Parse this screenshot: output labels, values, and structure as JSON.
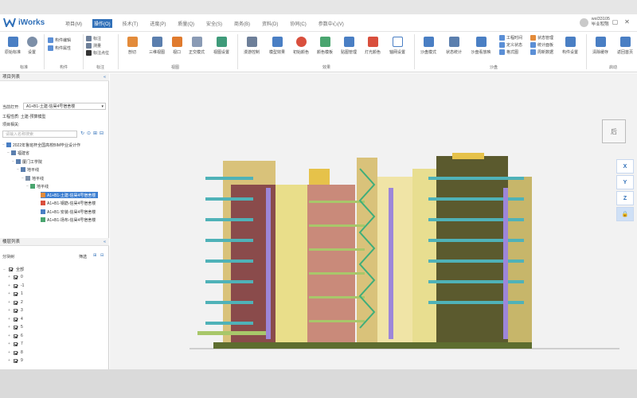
{
  "app": {
    "name": "iWorks",
    "menus": [
      "项目(M)",
      "操作(O)",
      "技术(T)",
      "进度(P)",
      "质量(Q)",
      "安全(S)",
      "商务(B)",
      "资料(D)",
      "协同(C)",
      "参数中心(V)"
    ],
    "active_menu": "操作(O)",
    "user_name": "wsl33105",
    "user_sub": "毕业权限",
    "window_buttons": [
      "—",
      "▢",
      "✕"
    ]
  },
  "ribbon": {
    "groups": [
      "标准",
      "构件",
      "标注",
      "视图",
      "效果",
      "沙盘",
      "启动"
    ],
    "buttons": {
      "origin_std": "原始标准",
      "settings": "设置",
      "comp_edit": "构件编辑",
      "comp_attr": "构件属性",
      "mark": "标注",
      "measure": "测量",
      "mark_points": "标注点位",
      "cut": "剖切",
      "three_view": "三维视图",
      "viewport": "视口",
      "ortho": "正交模式",
      "view_settings": "视图设置",
      "view_control": "漫游控制",
      "model_effect": "模型效果",
      "init_color": "初始颜色",
      "color_template": "颜色模板",
      "texture_manage": "贴图管理",
      "light_color": "灯光颜色",
      "grid_settings": "轴网设置",
      "sandbox_mode": "沙盘模式",
      "status_stats": "状态统计",
      "sandbox_marks": "沙盘看放映",
      "project_time": "工程时间",
      "define_status": "定义状态",
      "legend": "格式图",
      "status_manage": "状态管理",
      "stats_panel": "统计面板",
      "count_data": "周新数据",
      "comp_settings": "构件设置",
      "clear_cache": "清除缓存",
      "back_home": "返回首页"
    }
  },
  "project_panel": {
    "title": "项目列表",
    "current_open_label": "当前打开:",
    "current_open_value": "A1+B1-土建-信昊4号宿舍楼",
    "project_type": "工程性质: 土建-预算模型",
    "related_label": "项目相关:",
    "search_placeholder": "请输入名称搜索",
    "tree": [
      "2022年鲁班杯全国高校BIM毕业设计作",
      "福建省",
      "厦门工学院",
      "地平线",
      "地平线",
      "地平线",
      "A1+B1-土建-信昊4号宿舍楼",
      "A1+B1-钢筋-信昊4号宿舍楼",
      "A1+B1-安装-信昊4号宿舍楼",
      "A1+B1-场布-信昊4号宿舍楼"
    ]
  },
  "floor_panel": {
    "title": "楼层列表",
    "filter_label": "分块树",
    "filter_btn": "筛选",
    "root": "全部",
    "floors": [
      "0",
      "-1",
      "1",
      "2",
      "3",
      "4",
      "5",
      "6",
      "7",
      "8",
      "9"
    ]
  },
  "viewport": {
    "back_btn": "后",
    "axis_buttons": [
      "X",
      "Y",
      "Z"
    ]
  },
  "colors": {
    "accent": "#2f6fb8",
    "selected": "#3d7fd1"
  }
}
